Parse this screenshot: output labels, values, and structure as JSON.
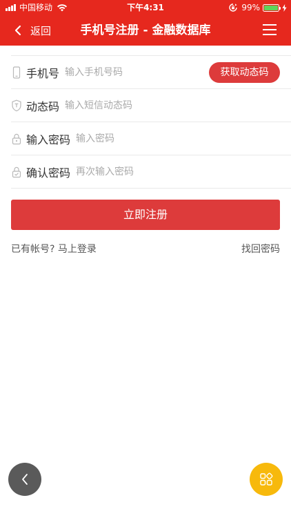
{
  "status_bar": {
    "carrier": "中国移动",
    "time": "下午4:31",
    "battery": "99%",
    "battery_level": 0.99,
    "icons": [
      "signal-icon",
      "wifi-icon",
      "rotation-lock-icon",
      "battery-icon",
      "charging-bolt-icon"
    ]
  },
  "nav": {
    "back_label": "返回",
    "title": "手机号注册 - 金融数据库",
    "back_icon": "chevron-left-icon",
    "menu_icon": "hamburger-menu-icon"
  },
  "form": {
    "phone": {
      "label": "手机号",
      "placeholder": "输入手机号码",
      "value": "",
      "icon": "phone-icon"
    },
    "get_code_button": "获取动态码",
    "code": {
      "label": "动态码",
      "placeholder": "输入短信动态码",
      "value": "",
      "icon": "shield-icon"
    },
    "password": {
      "label": "输入密码",
      "placeholder": "输入密码",
      "value": "",
      "icon": "lock-icon"
    },
    "confirm_password": {
      "label": "确认密码",
      "placeholder": "再次输入密码",
      "value": "",
      "icon": "lock-check-icon"
    },
    "submit_button": "立即注册"
  },
  "links": {
    "login": "已有帐号? 马上登录",
    "forgot_password": "找回密码"
  },
  "floating": {
    "back_icon": "chevron-left-icon",
    "apps_icon": "grid-icon"
  },
  "colors": {
    "header_bg": "#e6281e",
    "button_red": "#dd3b3b",
    "fab_back": "#5a5a5a",
    "fab_apps": "#f7b90c",
    "battery_green": "#5fd35a"
  }
}
